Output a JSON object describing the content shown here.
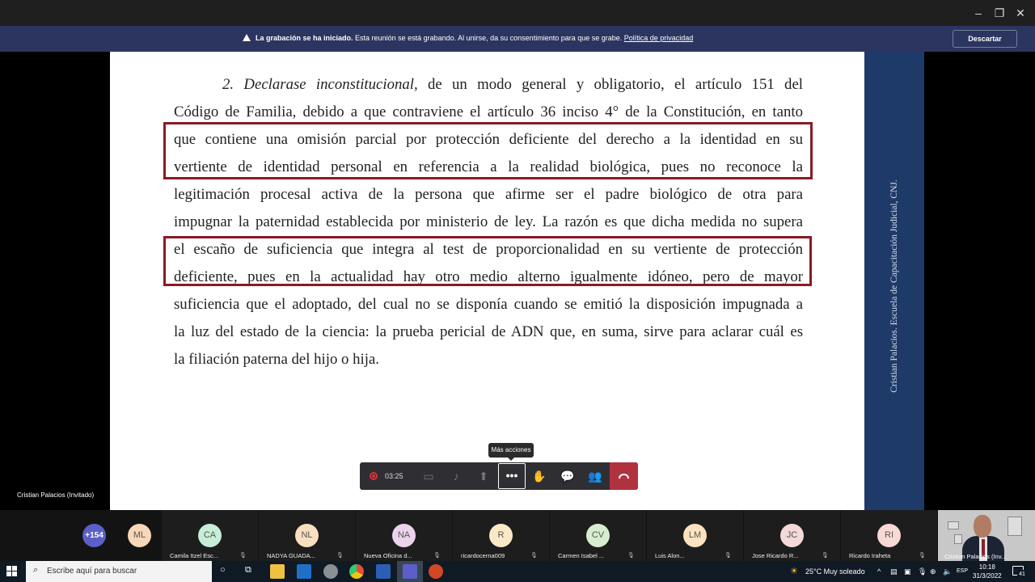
{
  "recording_banner": {
    "bold": "La grabación se ha iniciado.",
    "text": " Esta reunión se está grabando. Al unirse, da su consentimiento para que se grabe. ",
    "link": "Política de privacidad",
    "dismiss": "Descartar"
  },
  "slide": {
    "lines": [
      {
        "pre": "2. ",
        "italic": "Declarase inconstitucional,",
        "rest": " de un modo general y obligatorio, el artículo 151 del"
      },
      {
        "text": "Código de Familia, debido a que contraviene el artículo 36 inciso 4° de la Constitución, en tanto"
      },
      {
        "text": "que contiene una omisión parcial por protección deficiente del derecho a la identidad en su"
      },
      {
        "text": "vertiente de identidad personal en referencia a la realidad biológica, pues no reconoce la"
      },
      {
        "text": "legitimación procesal activa de la persona que afirme ser el padre biológico de otra para"
      },
      {
        "text": "impugnar la paternidad establecida por ministerio de ley. La razón es que dicha medida no supera"
      },
      {
        "text": "el escaño de suficiencia que integra al test de proporcionalidad en su vertiente de protección"
      },
      {
        "text": "deficiente, pues en la actualidad hay otro medio alterno igualmente idóneo, pero de mayor"
      },
      {
        "text": "suficiencia que el adoptado, del cual no se disponía cuando se emitió la disposición impugnada a"
      },
      {
        "text": "la luz del estado de la ciencia: la prueba pericial de ADN que, en suma, sirve para aclarar cuál es"
      },
      {
        "text": "la filiación paterna del hijo o hija."
      }
    ],
    "side_caption": "Cristian Palacios. Escuela de Capacitación Judicial, CNJ.",
    "highlight_color": "#8b1a24"
  },
  "presenter_caption": "Cristian Palacios (Invitado)",
  "tooltip": "Más acciones",
  "controls": {
    "recording_time": "03:25",
    "more_actions_glyph": "•••",
    "hangup_color": "#b0323f"
  },
  "participants": {
    "overflow": "+154",
    "tiles": [
      {
        "initials": "ML",
        "name": "",
        "color": "#f6d7b8"
      },
      {
        "initials": "CA",
        "name": "Camila Itzel Esc...",
        "color": "#c7ecd7"
      },
      {
        "initials": "NL",
        "name": "NADYA GUADA...",
        "color": "#f8dfc0"
      },
      {
        "initials": "NA",
        "name": "Nueva Oficina d...",
        "color": "#ecd3ec"
      },
      {
        "initials": "R",
        "name": "ricardocerna009",
        "color": "#fbe9c6"
      },
      {
        "initials": "CV",
        "name": "Carmen Isabel ...",
        "color": "#d8edcf"
      },
      {
        "initials": "LM",
        "name": "Luis Alon...",
        "color": "#fbe3bf"
      },
      {
        "initials": "JC",
        "name": "Jose Ricardo R...",
        "color": "#f4d9d9"
      },
      {
        "initials": "RI",
        "name": "Ricardo Iraheta",
        "color": "#f8d9d6"
      }
    ],
    "self_name": "Cristian Palacios (Inv..."
  },
  "taskbar": {
    "search_placeholder": "Escribe aquí para buscar",
    "weather": "25°C  Muy soleado",
    "language": "ESP",
    "time": "10:18",
    "date": "31/3/2022",
    "notifications": "41"
  }
}
